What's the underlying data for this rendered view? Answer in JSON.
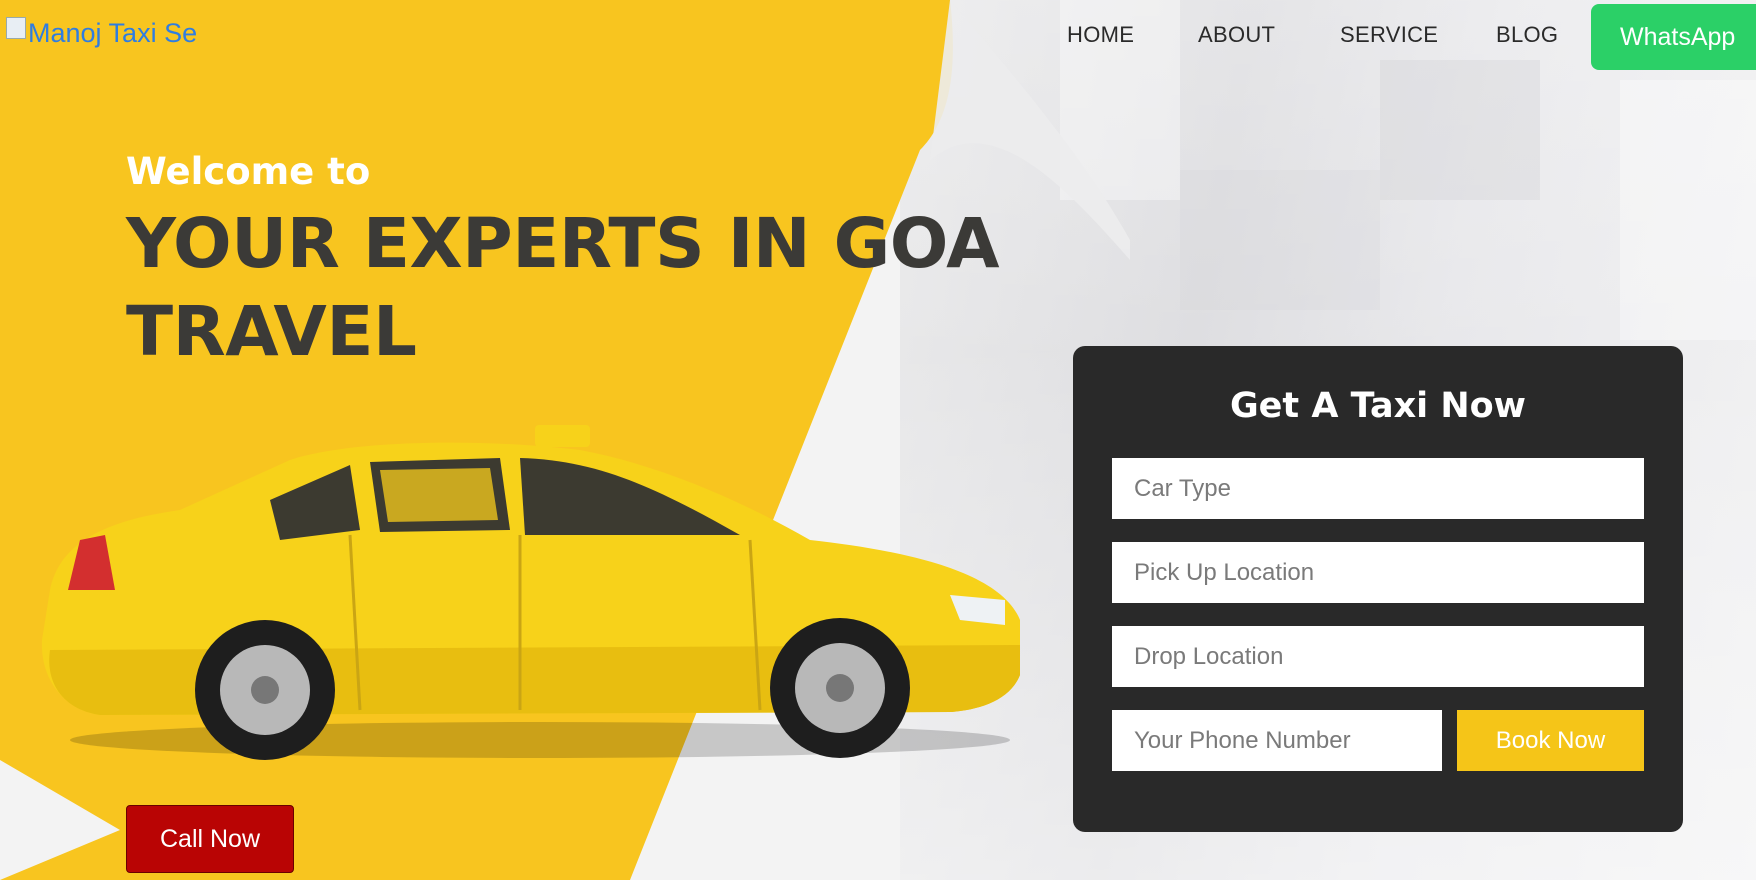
{
  "logo": {
    "alt_text": "Manoj Taxi Se"
  },
  "nav": {
    "home": "HOME",
    "about": "ABOUT",
    "service": "SERVICE",
    "blog": "BLOG",
    "whatsapp": "WhatsApp"
  },
  "hero": {
    "welcome": "Welcome to",
    "headline_line1": "YOUR EXPERTS IN GOA",
    "headline_line2": "TRAVEL",
    "call_button": "Call Now"
  },
  "form": {
    "title": "Get A Taxi Now",
    "car_type_placeholder": "Car Type",
    "pickup_placeholder": "Pick Up Location",
    "drop_placeholder": "Drop Location",
    "phone_placeholder": "Your Phone Number",
    "book_button": "Book Now"
  },
  "colors": {
    "brand_yellow": "#f8c51f",
    "form_bg": "#292929",
    "whatsapp_green": "#2bd067",
    "call_red": "#b90404",
    "headline_dark": "#3b3a37"
  }
}
